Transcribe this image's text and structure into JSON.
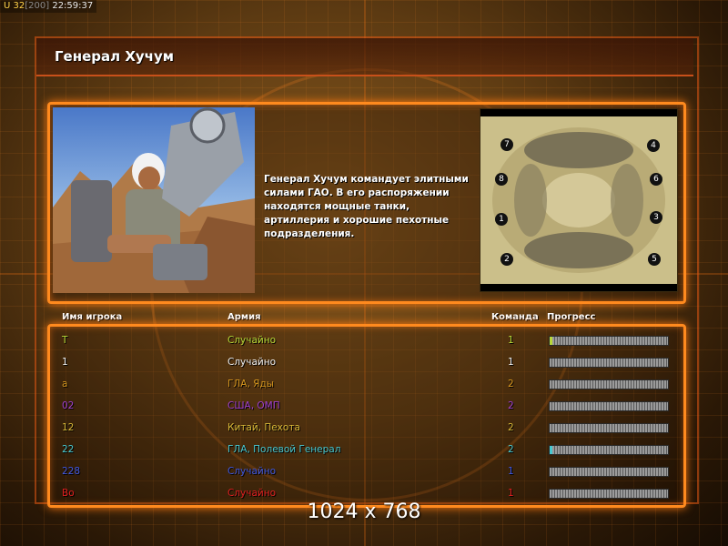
{
  "status_bar": {
    "prefix": "U",
    "value": "32",
    "limit": "[200]",
    "time": "22:59:37"
  },
  "general": {
    "title": "Генерал Хучум",
    "description": "Генерал Хучум командует элитными силами ГАО. В его распоряжении находятся мощные танки, артиллерия и хорошие пехотные подразделения."
  },
  "map": {
    "start_positions": [
      "1",
      "2",
      "3",
      "4",
      "5",
      "6",
      "7",
      "8"
    ]
  },
  "table": {
    "headers": {
      "player": "Имя игрока",
      "army": "Армия",
      "team": "Команда",
      "progress": "Прогресс"
    },
    "rows": [
      {
        "player": "Т",
        "army": "Случайно",
        "team": "1",
        "color": "#b8d838",
        "progress": 0.02
      },
      {
        "player": "1",
        "army": "Случайно",
        "team": "1",
        "color": "#f0f0f0",
        "progress": 0
      },
      {
        "player": "а",
        "army": "ГЛА, Яды",
        "team": "2",
        "color": "#d89820",
        "progress": 0
      },
      {
        "player": "02",
        "army": "США, ОМП",
        "team": "2",
        "color": "#a040d0",
        "progress": 0
      },
      {
        "player": "12",
        "army": "Китай, Пехота",
        "team": "2",
        "color": "#d8b838",
        "progress": 0
      },
      {
        "player": "22",
        "army": "ГЛА, Полевой Генерал",
        "team": "2",
        "color": "#48c8d0",
        "progress": 0.02
      },
      {
        "player": "228",
        "army": "Случайно",
        "team": "1",
        "color": "#4058e0",
        "progress": 0
      },
      {
        "player": "Во",
        "army": "Случайно",
        "team": "1",
        "color": "#e02020",
        "progress": 0
      }
    ]
  },
  "resolution": "1024 x 768"
}
